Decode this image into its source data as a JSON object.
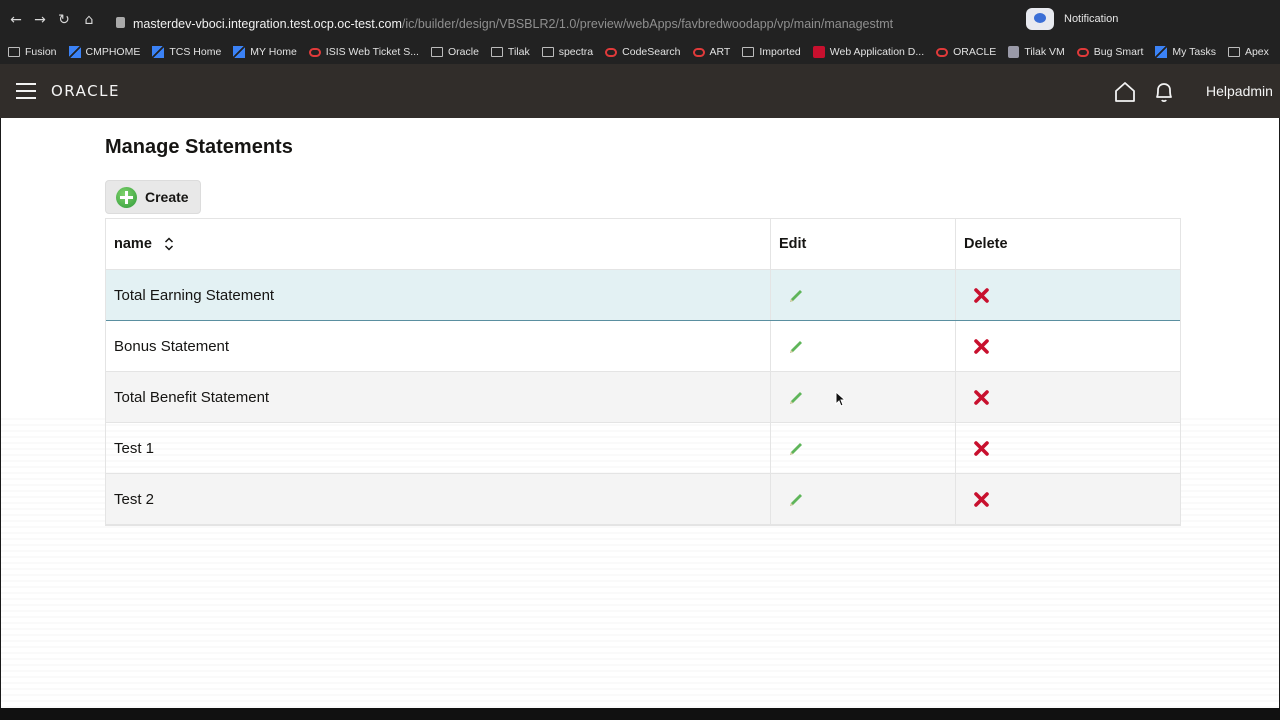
{
  "browser": {
    "url_host": "masterdev-vboci.integration.test.ocp.oc-test.com",
    "url_path": "/ic/builder/design/VBSBLR2/1.0/preview/webApps/favbredwoodapp/vp/main/managestmt",
    "notification_label": "Notification",
    "bookmarks": [
      {
        "label": "Fusion",
        "icon": "folder"
      },
      {
        "label": "CMPHOME",
        "icon": "blue"
      },
      {
        "label": "TCS Home",
        "icon": "blue"
      },
      {
        "label": "MY Home",
        "icon": "blue"
      },
      {
        "label": "ISIS Web Ticket S...",
        "icon": "oracle"
      },
      {
        "label": "Oracle",
        "icon": "folder"
      },
      {
        "label": "Tilak",
        "icon": "folder"
      },
      {
        "label": "spectra",
        "icon": "folder"
      },
      {
        "label": "CodeSearch",
        "icon": "oracle"
      },
      {
        "label": "ART",
        "icon": "oracle"
      },
      {
        "label": "Imported",
        "icon": "folder"
      },
      {
        "label": "Web Application D...",
        "icon": "red"
      },
      {
        "label": "ORACLE",
        "icon": "oracle"
      },
      {
        "label": "Tilak VM",
        "icon": "grey"
      },
      {
        "label": "Bug Smart",
        "icon": "oracle"
      },
      {
        "label": "My Tasks",
        "icon": "blue"
      },
      {
        "label": "Apex",
        "icon": "folder"
      }
    ],
    "bookmarks_more": "»"
  },
  "header": {
    "brand": "ORACLE",
    "user": "Helpadmin"
  },
  "page": {
    "title": "Manage Statements",
    "create_label": "Create"
  },
  "table": {
    "columns": [
      "name",
      "Edit",
      "Delete"
    ],
    "rows": [
      {
        "name": "Total Earning Statement",
        "selected": true
      },
      {
        "name": "Bonus Statement",
        "selected": false
      },
      {
        "name": "Total Benefit Statement",
        "selected": false
      },
      {
        "name": "Test 1",
        "selected": false
      },
      {
        "name": "Test 2",
        "selected": false
      }
    ]
  },
  "colors": {
    "header_bg": "#312d2a",
    "selected_row": "#e3f1f3",
    "edit_icon": "#5fb55a",
    "delete_icon": "#c8102e"
  }
}
